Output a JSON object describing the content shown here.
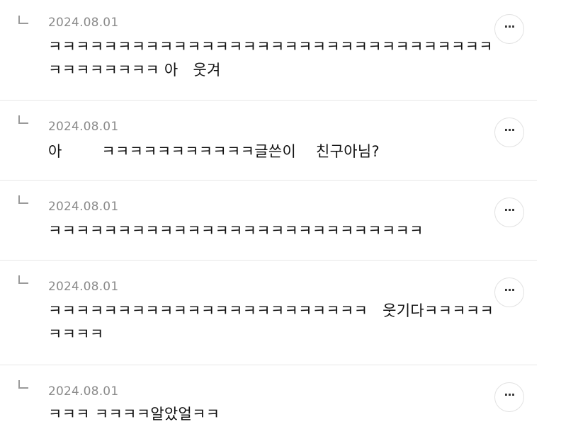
{
  "comments": [
    {
      "date": "2024.08.01",
      "text": "ㅋㅋㅋㅋㅋㅋㅋㅋㅋㅋㅋㅋㅋㅋㅋㅋㅋㅋㅋㅋㅋㅋㅋㅋㅋㅋㅋㅋㅋㅋㅋㅋㅋㅋㅋㅋㅋㅋㅋㅋ 아   웃겨",
      "more_icon": "more-horizontal-icon"
    },
    {
      "date": "2024.08.01",
      "text": "아        ㅋㅋㅋㅋㅋㅋㅋㅋㅋㅋㅋ글쓴이    친구아님?",
      "more_icon": "more-horizontal-icon"
    },
    {
      "date": "2024.08.01",
      "text": "ㅋㅋㅋㅋㅋㅋㅋㅋㅋㅋㅋㅋㅋㅋㅋㅋㅋㅋㅋㅋㅋㅋㅋㅋㅋㅋㅋ",
      "more_icon": "more-horizontal-icon"
    },
    {
      "date": "2024.08.01",
      "text": "ㅋㅋㅋㅋㅋㅋㅋㅋㅋㅋㅋㅋㅋㅋㅋㅋㅋㅋㅋㅋㅋㅋㅋ   웃기다ㅋㅋㅋㅋㅋㅋㅋㅋㅋ",
      "more_icon": "more-horizontal-icon"
    },
    {
      "date": "2024.08.01",
      "text": "ㅋㅋㅋ ㅋㅋㅋㅋ알았얼ㅋㅋ",
      "more_icon": "more-horizontal-icon"
    }
  ],
  "more_button_label": "···"
}
